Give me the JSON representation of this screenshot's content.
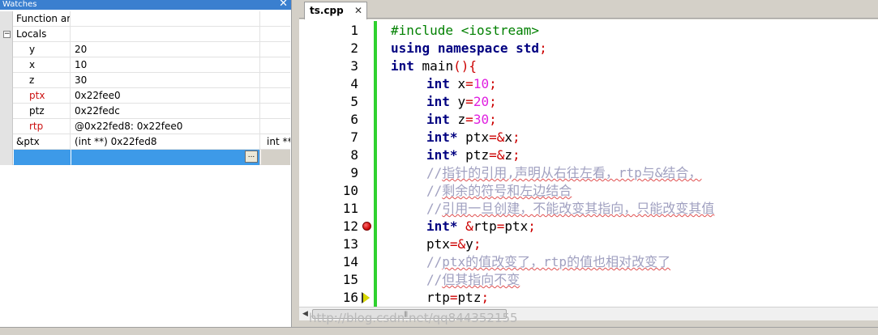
{
  "watches": {
    "title": "Watches",
    "close_glyph": "✕",
    "rows": [
      {
        "name": "Function arg",
        "value": "",
        "type": ""
      },
      {
        "name": "Locals",
        "expander": "−"
      },
      {
        "name": "y",
        "value": "20"
      },
      {
        "name": "x",
        "value": "10"
      },
      {
        "name": "z",
        "value": "30"
      },
      {
        "name": "ptx",
        "value": "0x22fee0"
      },
      {
        "name": "ptz",
        "value": "0x22fedc"
      },
      {
        "name": "rtp",
        "value": "@0x22fed8: 0x22fee0"
      },
      {
        "name": "&ptx",
        "value": "(int **) 0x22fed8",
        "type": "int **"
      },
      {
        "name": "",
        "value": "",
        "button": "..."
      }
    ]
  },
  "editor": {
    "tab_label": "ts.cpp",
    "tab_close": "✕",
    "line_numbers": [
      "1",
      "2",
      "3",
      "4",
      "5",
      "6",
      "7",
      "8",
      "9",
      "10",
      "11",
      "12",
      "13",
      "14",
      "15",
      "16"
    ],
    "lines": {
      "l1_pp": "#include <iostream>",
      "l2_kw1": "using",
      "l2_kw2": "namespace",
      "l2_kw3": "std",
      "l2_semi": ";",
      "l3_kw": "int",
      "l3_rest": " main",
      "l3_paren": "(){",
      "l4_kw": "int",
      "l4_a": " x",
      "l4_eq": "=",
      "l4_num": "10",
      "l4_semi": ";",
      "l5_kw": "int",
      "l5_a": " y",
      "l5_eq": "=",
      "l5_num": "20",
      "l5_semi": ";",
      "l6_kw": "int",
      "l6_a": " z",
      "l6_eq": "=",
      "l6_num": "30",
      "l6_semi": ";",
      "l7_kw": "int",
      "l7_star": "*",
      "l7_a": " ptx",
      "l7_op": "=&",
      "l7_b": "x",
      "l7_semi": ";",
      "l8_kw": "int",
      "l8_star": "*",
      "l8_a": " ptz",
      "l8_op": "=&",
      "l8_b": "z",
      "l8_semi": ";",
      "l9_slash": "//",
      "l9_text": "指针的引用,声明从右往左看，rtp与&结合，",
      "l10_slash": "//",
      "l10_text": "剩余的符号和左边结合",
      "l11_slash": "//",
      "l11_text": "引用一旦创建，不能改变其指向，只能改变其值",
      "l12_kw": "int",
      "l12_star": "*",
      "l12_amp": " &",
      "l12_a": "rtp",
      "l12_eq": "=",
      "l12_b": "ptx",
      "l12_semi": ";",
      "l13_a": "ptx",
      "l13_op": "=&",
      "l13_b": "y",
      "l13_semi": ";",
      "l14_slash": "//",
      "l14_text": "ptx的值改变了，rtp的值也相对改变了",
      "l15_slash": "//",
      "l15_text": "但其指向不变",
      "l16_a": "rtp",
      "l16_eq": "=",
      "l16_b": "ptz",
      "l16_semi": ";"
    },
    "breakpoint_line": 12,
    "current_line": 16
  },
  "scrollbar": {
    "left_arrow": "◀",
    "grip": "|||"
  },
  "watermark": "http://blog.csdn.net/qq844352155",
  "colors": {
    "title_bar": "#3a7fcf",
    "changed_value": "#cc1111",
    "keyword": "#000080",
    "preprocessor": "#008000",
    "number": "#e020e0",
    "comment": "#a0a0c0",
    "change_bar": "#2fd12f",
    "selection": "#3d9ae8"
  }
}
